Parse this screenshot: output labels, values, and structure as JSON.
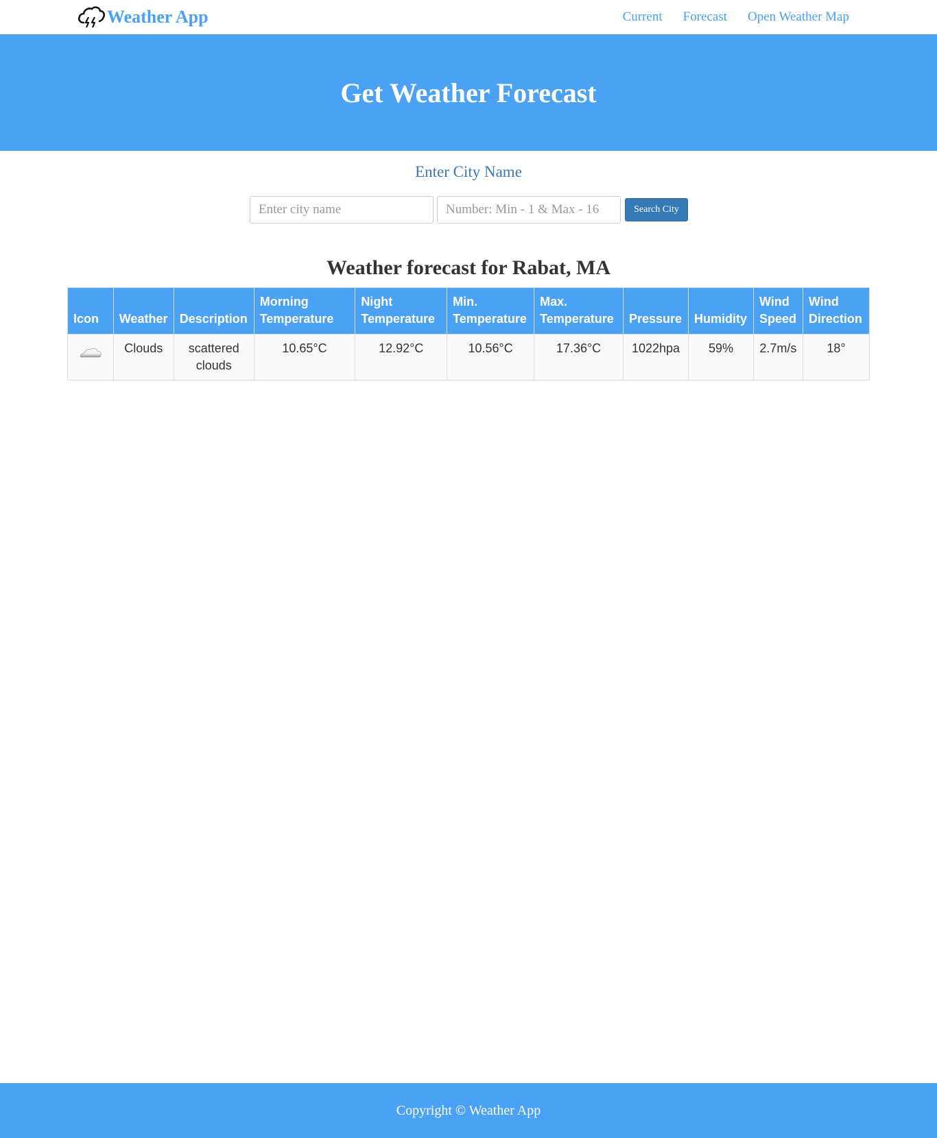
{
  "navbar": {
    "brand_icon": "thunder-cloud-icon",
    "brand": "Weather App",
    "links": [
      "Current",
      "Forecast",
      "Open Weather Map"
    ]
  },
  "hero": {
    "title": "Get Weather Forecast"
  },
  "search": {
    "label": "Enter City Name",
    "city_placeholder": "Enter city name",
    "city_value": "",
    "days_placeholder": "Number: Min - 1 & Max - 16",
    "days_value": "",
    "button": "Search City"
  },
  "forecast": {
    "title": "Weather forecast for Rabat, MA",
    "headers": [
      "Icon",
      "Weather",
      "Description",
      "Morning Temperature",
      "Night Temperature",
      "Min. Temperature",
      "Max. Temperature",
      "Pressure",
      "Humidity",
      "Wind Speed",
      "Wind Direction"
    ],
    "rows": [
      {
        "icon": "scattered-clouds-icon",
        "weather": "Clouds",
        "description": "scattered clouds",
        "morning_temp": "10.65°C",
        "night_temp": "12.92°C",
        "min_temp": "10.56°C",
        "max_temp": "17.36°C",
        "pressure": "1022hpa",
        "humidity": "59%",
        "wind_speed": "2.7m/s",
        "wind_direction": "18°"
      }
    ]
  },
  "footer": {
    "text": "Copyright © Weather App"
  },
  "colors": {
    "accent": "#4ba1f3",
    "nav_link": "#4aa0f2",
    "button": "#337ab7",
    "label": "#3a78b5"
  }
}
